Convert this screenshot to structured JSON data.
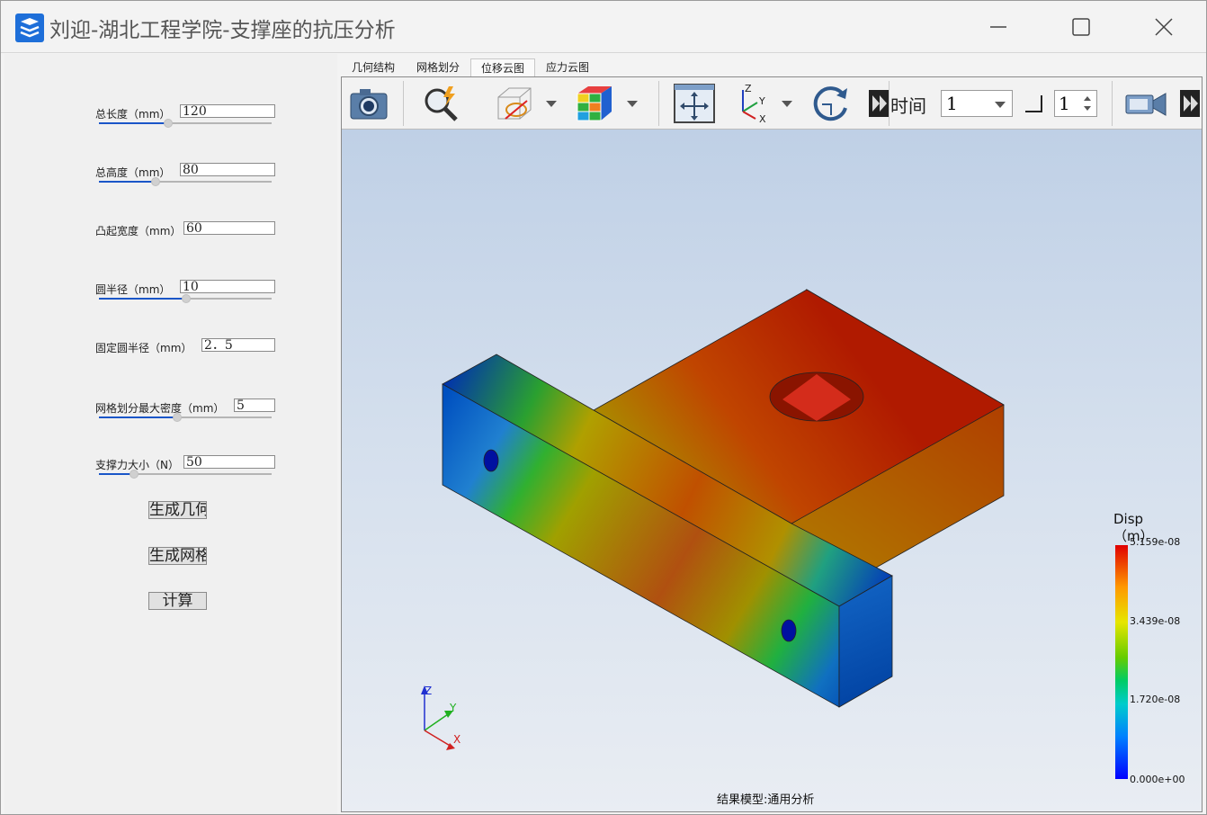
{
  "window": {
    "title": "刘迎-湖北工程学院-支撑座的抗压分析"
  },
  "params": [
    {
      "label": "总长度（mm）",
      "value": "120",
      "slider_fraction": 0.4
    },
    {
      "label": "总高度（mm）",
      "value": "80",
      "slider_fraction": 0.33
    },
    {
      "label": "凸起宽度（mm）",
      "value": "60"
    },
    {
      "label": "圆半径（mm）",
      "value": "10",
      "slider_fraction": 0.5
    },
    {
      "label": "固定圆半径（mm）",
      "value": "2．5"
    },
    {
      "label": "网格划分最大密度（mm）",
      "value": "5",
      "slider_fraction": 0.45
    },
    {
      "label": "支撑力大小（N）",
      "value": "50",
      "slider_fraction": 0.2
    }
  ],
  "buttons": {
    "geometry": "生成几何",
    "mesh": "生成网格",
    "compute": "计算"
  },
  "tabs": [
    "几何结构",
    "网格划分",
    "位移云图",
    "应力云图"
  ],
  "active_tab": 2,
  "toolbar": {
    "time_label": "时间",
    "time_value": "1",
    "step_value": "1",
    "icons": [
      "camera-icon",
      "zoom-icon",
      "view-box-icon",
      "color-cube-icon",
      "fit-icon",
      "axes-icon",
      "rotate-icon",
      "video-icon"
    ]
  },
  "legend": {
    "title": "Disp",
    "unit": "（m）",
    "values": [
      "5.159e-08",
      "3.439e-08",
      "1.720e-08",
      "0.000e+00"
    ]
  },
  "caption": "结果模型:通用分析",
  "axis_labels": {
    "x": "X",
    "y": "Y",
    "z": "Z"
  },
  "colors": {
    "accent": "#1a56c8",
    "max": "#e00000",
    "min": "#0000ff"
  }
}
